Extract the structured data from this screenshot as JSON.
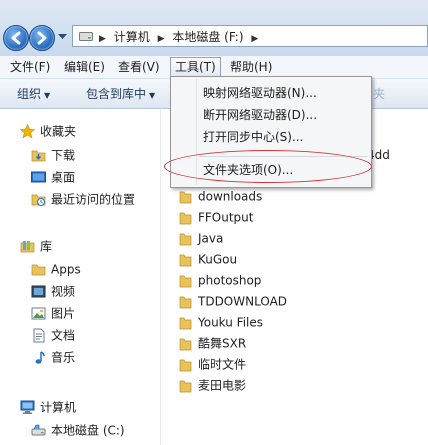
{
  "address": {
    "crumbs": [
      "计算机",
      "本地磁盘 (F:)"
    ]
  },
  "menubar": {
    "items": [
      "文件(F)",
      "编辑(E)",
      "查看(V)",
      "工具(T)",
      "帮助(H)"
    ],
    "active_index": 3
  },
  "toolbar": {
    "organize": "组织",
    "include_library": "包含到库中",
    "new_folder_partial": "夹"
  },
  "tools_menu": {
    "items": [
      "映射网络驱动器(N)...",
      "断开网络驱动器(D)...",
      "打开同步中心(S)...",
      "文件夹选项(O)..."
    ],
    "circled_item": "文件夹选项(O)...",
    "circle_color": "#d33636"
  },
  "nav": {
    "favorites": {
      "label": "收藏夹",
      "items": [
        "下载",
        "桌面",
        "最近访问的位置"
      ]
    },
    "libraries": {
      "label": "库",
      "items": [
        "Apps",
        "视频",
        "图片",
        "文档",
        "音乐"
      ]
    },
    "computer": {
      "label": "计算机",
      "items": [
        "本地磁盘 (C:)"
      ]
    }
  },
  "content": {
    "partial_name": "4dd",
    "folders": [
      "downloads",
      "FFOutput",
      "Java",
      "KuGou",
      "photoshop",
      "TDDOWNLOAD",
      "Youku Files",
      "酷舞SXR",
      "临时文件",
      "麦田电影"
    ]
  },
  "colors": {
    "folder": "#e8c25a",
    "accent_blue": "#2a6fc4",
    "star": "#f0b400"
  }
}
